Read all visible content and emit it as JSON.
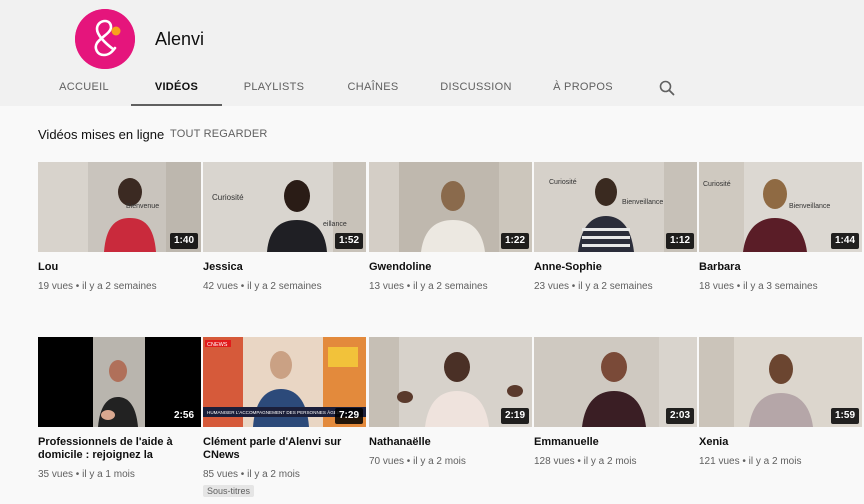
{
  "channel": {
    "name": "Alenvi",
    "logo_color": "#e5157c"
  },
  "tabs": [
    {
      "label": "ACCUEIL",
      "active": false
    },
    {
      "label": "VIDÉOS",
      "active": true
    },
    {
      "label": "PLAYLISTS",
      "active": false
    },
    {
      "label": "CHAÎNES",
      "active": false
    },
    {
      "label": "DISCUSSION",
      "active": false
    },
    {
      "label": "À PROPOS",
      "active": false
    }
  ],
  "search_icon": "search-icon",
  "section": {
    "title": "Vidéos mises en ligne",
    "play_all": "TOUT REGARDER"
  },
  "videos": [
    {
      "title": "Lou",
      "duration": "1:40",
      "views": "19 vues",
      "age": "il y a 2 semaines",
      "thumb_text": [
        "Bienvenue"
      ]
    },
    {
      "title": "Jessica",
      "duration": "1:52",
      "views": "42 vues",
      "age": "il y a 2 semaines",
      "thumb_text": [
        "Curiosité",
        "eillance"
      ]
    },
    {
      "title": "Gwendoline",
      "duration": "1:22",
      "views": "13 vues",
      "age": "il y a 2 semaines",
      "thumb_text": []
    },
    {
      "title": "Anne-Sophie",
      "duration": "1:12",
      "views": "23 vues",
      "age": "il y a 2 semaines",
      "thumb_text": [
        "Curiosité",
        "Bienveillance"
      ]
    },
    {
      "title": "Barbara",
      "duration": "1:44",
      "views": "18 vues",
      "age": "il y a 3 semaines",
      "thumb_text": [
        "Curiosité",
        "Bienveillance"
      ]
    },
    {
      "title": "Professionnels de l'aide à domicile : rejoignez la",
      "duration": "2:56",
      "views": "35 vues",
      "age": "il y a 1 mois",
      "thumb_text": []
    },
    {
      "title": "Clément parle d'Alenvi sur CNews",
      "duration": "7:29",
      "views": "85 vues",
      "age": "il y a 2 mois",
      "badge": "Sous-titres",
      "thumb_text": [
        "CNEWS",
        "HUMANISER L'ACCOMPAGNEMENT DES PERSONNES ÂGÉES"
      ]
    },
    {
      "title": "Nathanaëlle",
      "duration": "2:19",
      "views": "70 vues",
      "age": "il y a 2 mois",
      "thumb_text": []
    },
    {
      "title": "Emmanuelle",
      "duration": "2:03",
      "views": "128 vues",
      "age": "il y a 2 mois",
      "thumb_text": []
    },
    {
      "title": "Xenia",
      "duration": "1:59",
      "views": "121 vues",
      "age": "il y a 2 mois",
      "thumb_text": []
    }
  ]
}
